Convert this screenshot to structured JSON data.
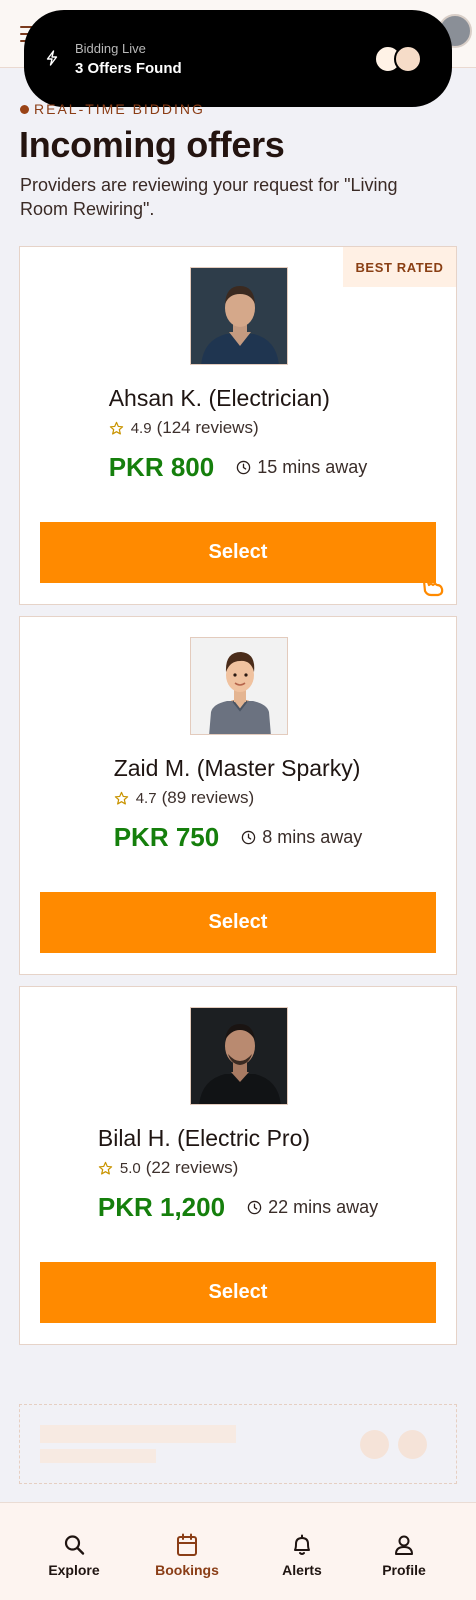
{
  "island": {
    "subtitle": "Bidding Live",
    "title": "3 Offers Found"
  },
  "hero": {
    "eyebrow": "Real-Time Bidding",
    "title": "Incoming offers",
    "subtitle": "Providers are reviewing your request for \"Living Room Rewiring\"."
  },
  "offers": [
    {
      "name": "Ahsan K. (Electrician)",
      "rating": "4.9",
      "reviews": "(124 reviews)",
      "price": "PKR 800",
      "distance": "15 mins away",
      "badge": "BEST RATED",
      "button": "Select"
    },
    {
      "name": "Zaid M. (Master Sparky)",
      "rating": "4.7",
      "reviews": "(89 reviews)",
      "price": "PKR 750",
      "distance": "8 mins away",
      "button": "Select"
    },
    {
      "name": "Bilal H. (Electric Pro)",
      "rating": "5.0",
      "reviews": "(22 reviews)",
      "price": "PKR 1,200",
      "distance": "22 mins away",
      "button": "Select"
    }
  ],
  "nav": {
    "items": [
      {
        "label": "Explore",
        "icon": "search-icon"
      },
      {
        "label": "Bookings",
        "icon": "calendar-icon",
        "active": true
      },
      {
        "label": "Alerts",
        "icon": "bell-icon"
      },
      {
        "label": "Profile",
        "icon": "user-icon"
      }
    ]
  },
  "colors": {
    "accent": "#ff8a00",
    "price": "#157f0c",
    "brand": "#8a3d16"
  }
}
